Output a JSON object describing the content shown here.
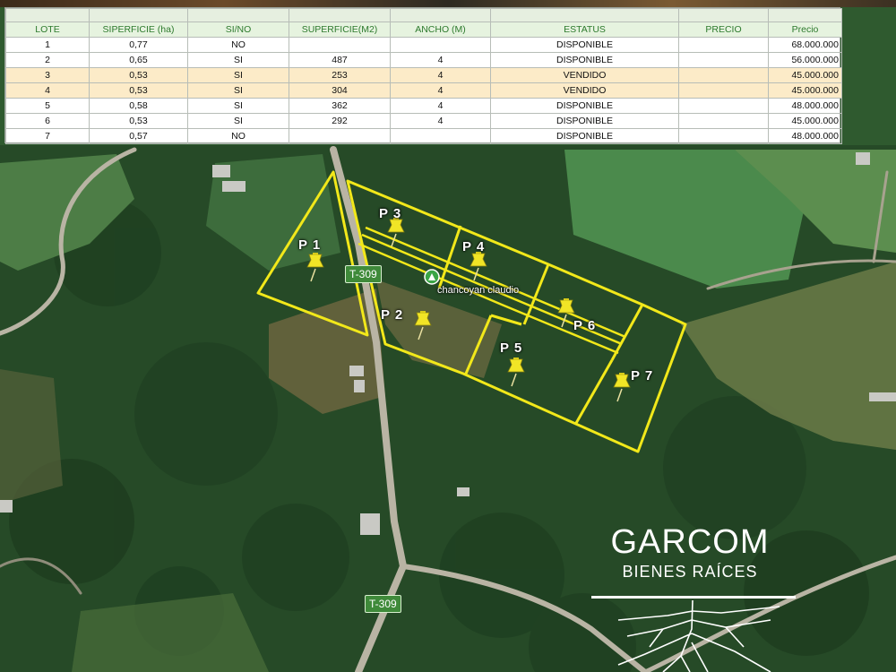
{
  "table": {
    "headers": {
      "lote": "LOTE",
      "superficie_ha": "SIPERFICIE (ha)",
      "si_no": "SI/NO",
      "superficie_m2": "SUPERFICIE(M2)",
      "ancho": "ANCHO (M)",
      "estatus": "ESTATUS",
      "precio": "PRECIO",
      "precio2": "Precio"
    },
    "rows": [
      {
        "lote": "1",
        "ha": "0,77",
        "sino": "NO",
        "m2": "",
        "ancho": "",
        "estatus": "DISPONIBLE",
        "precio": "",
        "precio2": "68.000.000"
      },
      {
        "lote": "2",
        "ha": "0,65",
        "sino": "SI",
        "m2": "487",
        "ancho": "4",
        "estatus": "DISPONIBLE",
        "precio": "",
        "precio2": "56.000.000"
      },
      {
        "lote": "3",
        "ha": "0,53",
        "sino": "SI",
        "m2": "253",
        "ancho": "4",
        "estatus": "VENDIDO",
        "precio": "",
        "precio2": "45.000.000"
      },
      {
        "lote": "4",
        "ha": "0,53",
        "sino": "SI",
        "m2": "304",
        "ancho": "4",
        "estatus": "VENDIDO",
        "precio": "",
        "precio2": "45.000.000"
      },
      {
        "lote": "5",
        "ha": "0,58",
        "sino": "SI",
        "m2": "362",
        "ancho": "4",
        "estatus": "DISPONIBLE",
        "precio": "",
        "precio2": "48.000.000"
      },
      {
        "lote": "6",
        "ha": "0,53",
        "sino": "SI",
        "m2": "292",
        "ancho": "4",
        "estatus": "DISPONIBLE",
        "precio": "",
        "precio2": "45.000.000"
      },
      {
        "lote": "7",
        "ha": "0,57",
        "sino": "NO",
        "m2": "",
        "ancho": "",
        "estatus": "DISPONIBLE",
        "precio": "",
        "precio2": "48.000.000"
      }
    ],
    "sold_status": "VENDIDO",
    "sold_color": "#fcebc8"
  },
  "map": {
    "road_sign_1": "T-309",
    "road_sign_2": "T-309",
    "place_name": "chancoyan claudio",
    "lots": [
      {
        "label": "P 1"
      },
      {
        "label": "P 2"
      },
      {
        "label": "P 3"
      },
      {
        "label": "P 4"
      },
      {
        "label": "P 5"
      },
      {
        "label": "P 6"
      },
      {
        "label": "P 7"
      }
    ],
    "boundary_color": "#f2e81a",
    "pin_icon": "pushpin-icon",
    "place_icon": "map-marker-icon"
  },
  "brand": {
    "name": "GARCOM",
    "subtitle": "BIENES RAÍCES",
    "logo_icon": "tree-roots-icon"
  }
}
